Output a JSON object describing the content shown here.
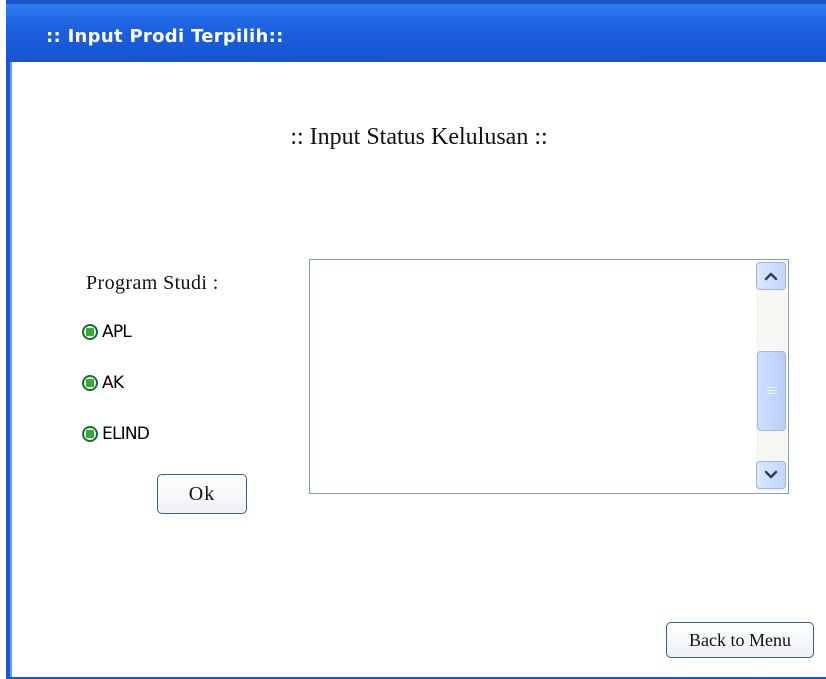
{
  "window": {
    "title": ":: Input Prodi Terpilih::"
  },
  "main": {
    "heading": ":: Input Status Kelulusan  ::",
    "program_label": "Program Studi :",
    "radios": [
      {
        "label": "APL"
      },
      {
        "label": "AK"
      },
      {
        "label": "ELIND"
      }
    ],
    "ok_label": "Ok",
    "back_label": "Back to Menu"
  },
  "colors": {
    "titlebar": "#1b5fdf",
    "radio_fill": "#2fae2f",
    "button_border": "#3b5e86",
    "listbox_border": "#7f9db9"
  },
  "icons": [
    "radio-selected-icon",
    "scroll-up-icon",
    "scroll-down-icon",
    "scroll-grip-icon"
  ]
}
